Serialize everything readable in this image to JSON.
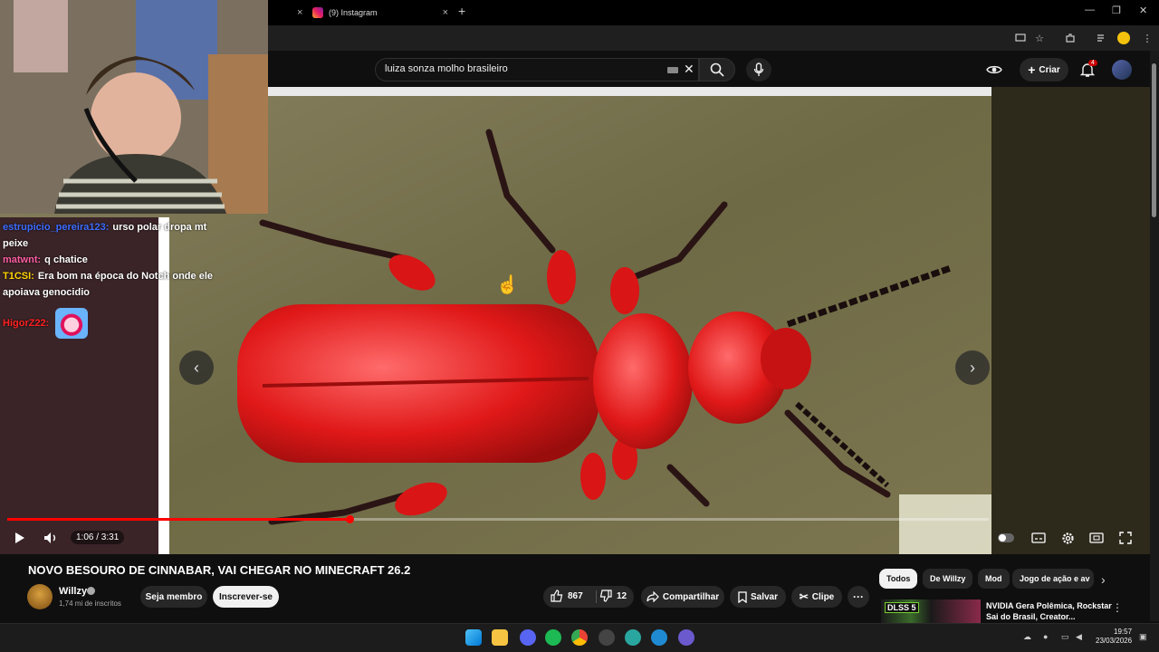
{
  "browser": {
    "tab_close_left": "×",
    "instagram_tab_title": "(9) Instagram",
    "instagram_tab_close": "×",
    "new_tab": "+",
    "window_controls": [
      "—",
      "❐",
      "✕"
    ]
  },
  "youtube": {
    "search": {
      "value": "luiza sonza molho brasileiro",
      "clear": "✕"
    },
    "create_label": "Criar",
    "notification_count": "4"
  },
  "stream_overlay": {
    "chat": [
      {
        "user": "estrupicio_pereira123:",
        "user_color": "#3d6cff",
        "message": "urso polar dropa mt peixe"
      },
      {
        "user": "matwnt:",
        "user_color": "#ff5da2",
        "message": "q chatice"
      },
      {
        "user": "T1CSI:",
        "user_color": "#ffd400",
        "message": "Era bom na época do Notch onde ele apoiava genocidio"
      },
      {
        "user": "HigorZ22:",
        "user_color": "#ff2020",
        "message": ""
      }
    ]
  },
  "player": {
    "progress": 0.349,
    "time": "1:06 / 3:31",
    "prev_arrow": "‹",
    "next_arrow": "›"
  },
  "video": {
    "title": "NOVO BESOURO DE CINNABAR, VAI CHEGAR NO MINECRAFT 26.2",
    "channel": "Willzy",
    "subscribers": "1,74 mi de inscritos",
    "member_label": "Seja membro",
    "subscribe_label": "Inscrever-se",
    "likes": "867",
    "dislikes": "12",
    "share_label": "Compartilhar",
    "save_label": "Salvar",
    "clip_label": "Clipe",
    "more_label": "···"
  },
  "chips": [
    "Todos",
    "De Willzy",
    "Mod",
    "Jogo de ação e av"
  ],
  "recommendation": {
    "title": "NVIDIA Gera Polêmica, Rockstar Sai do Brasil, Creator...",
    "thumb_badge": "DLSS 5"
  },
  "taskbar": {
    "time": "19:57",
    "date": "23/03/2026"
  },
  "colors": {
    "progress": "#ff0000",
    "beetle": "#e01818",
    "chat_background": "#3a2428"
  }
}
